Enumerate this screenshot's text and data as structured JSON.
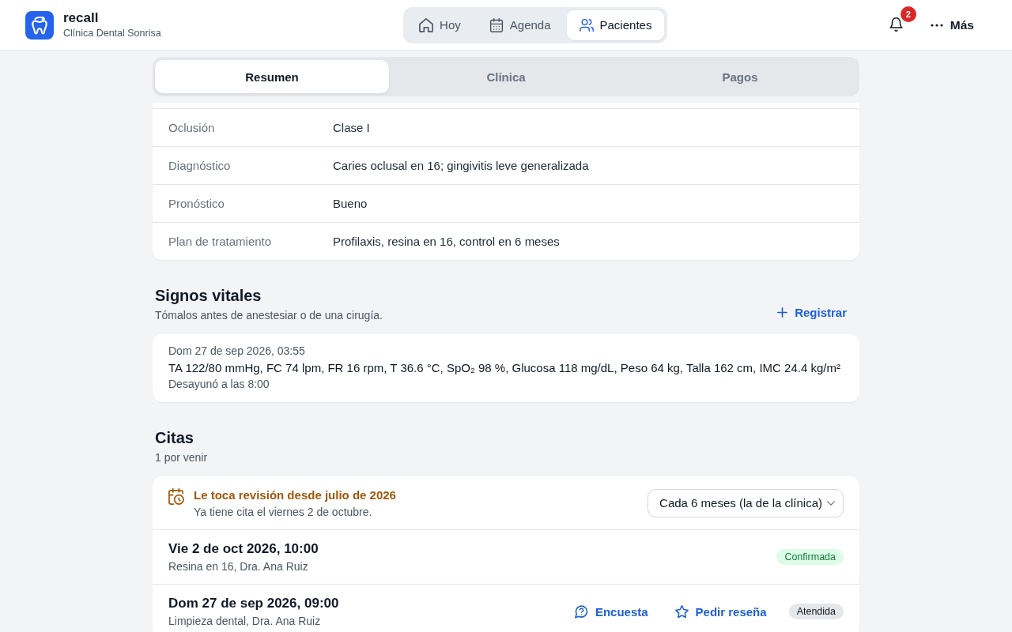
{
  "header": {
    "app_name": "recall",
    "clinic_name": "Clínica Dental Sonrisa",
    "nav": [
      {
        "kind": "today",
        "label": "Hoy",
        "selected": false
      },
      {
        "kind": "agenda",
        "label": "Agenda",
        "selected": false
      },
      {
        "kind": "patients",
        "label": "Pacientes",
        "selected": true
      }
    ],
    "notifications": {
      "count": "2"
    },
    "more": {
      "label": "Más"
    }
  },
  "tabs": [
    {
      "label": "Resumen",
      "selected": true
    },
    {
      "label": "Clínica",
      "selected": false
    },
    {
      "label": "Pagos",
      "selected": false
    }
  ],
  "exam": {
    "rows": [
      {
        "label": "Oclusión",
        "value": "Clase I"
      },
      {
        "label": "Diagnóstico",
        "value": "Caries oclusal en 16; gingivitis leve generalizada"
      },
      {
        "label": "Pronóstico",
        "value": "Bueno"
      },
      {
        "label": "Plan de tratamiento",
        "value": "Profilaxis, resina en 16, control en 6 meses"
      }
    ]
  },
  "vitals": {
    "title": "Signos vitales",
    "subtitle": "Tómalos antes de anestesiar o de una cirugía.",
    "add_button": "Registrar",
    "entries": [
      {
        "date": "Dom 27 de sep 2026, 03:55",
        "readings": "TA 122/80 mmHg, FC 74 lpm, FR 16 rpm, T 36.6 °C, SpO₂ 98 %, Glucosa 118 mg/dL, Peso 64 kg, Talla 162 cm, IMC 24.4 kg/m²",
        "note": "Desayunó a las 8:00"
      }
    ]
  },
  "appointments": {
    "title": "Citas",
    "subtitle": "1 por venir",
    "recall": {
      "title": "Le toca revisión desde julio de 2026",
      "detail": "Ya tiene cita el viernes 2 de octubre.",
      "interval": "Cada 6 meses (la de la clínica)"
    },
    "items": [
      {
        "date": "Vie 2 de oct 2026, 10:00",
        "detail": "Resina en 16, Dra. Ana Ruiz",
        "status": {
          "kind": "confirmed",
          "label": "Confirmada"
        }
      },
      {
        "date": "Dom 27 de sep 2026, 09:00",
        "detail": "Limpieza dental, Dra. Ana Ruiz",
        "status": {
          "kind": "attended",
          "label": "Atendida"
        },
        "actions": [
          {
            "kind": "survey",
            "label": "Encuesta"
          },
          {
            "kind": "review",
            "label": "Pedir reseña"
          }
        ]
      }
    ]
  }
}
